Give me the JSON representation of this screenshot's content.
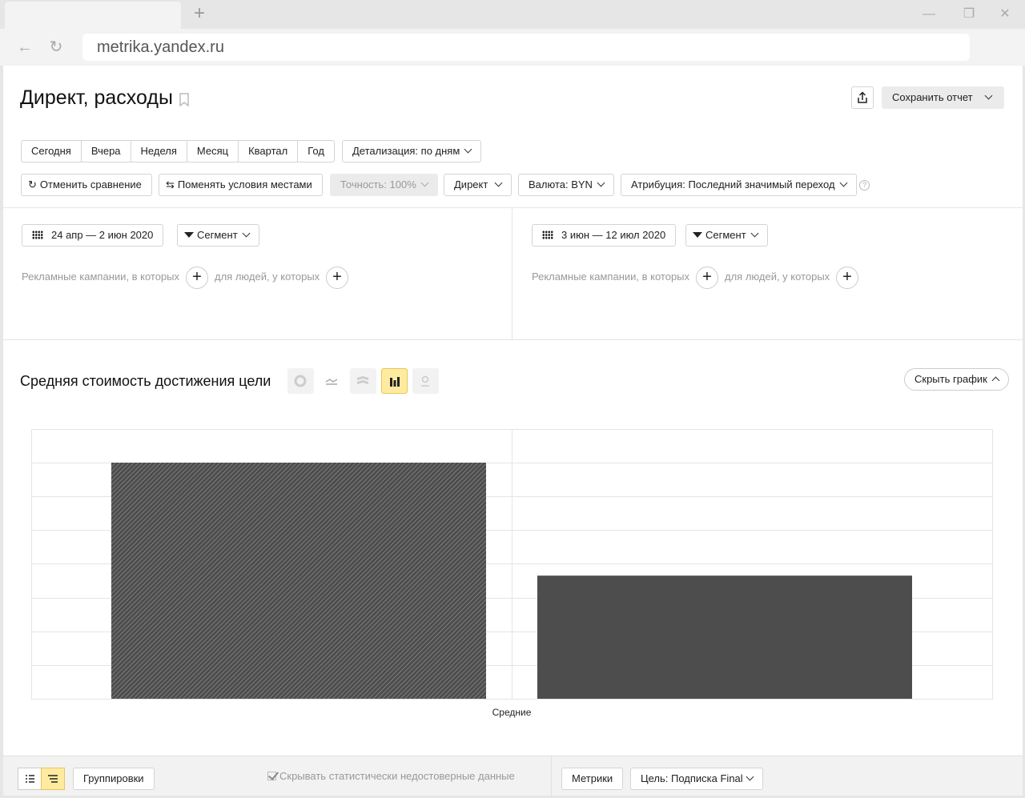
{
  "browser": {
    "address": "metrika.yandex.ru",
    "new_tab_glyph": "+",
    "back_glyph": "←",
    "reload_glyph": "↻",
    "minimize_glyph": "—",
    "restore_glyph": "❐",
    "close_glyph": "✕"
  },
  "report": {
    "title": "Директ, расходы",
    "save_label": "Сохранить отчет",
    "period_buttons": [
      "Сегодня",
      "Вчера",
      "Неделя",
      "Месяц",
      "Квартал",
      "Год"
    ],
    "detail_label": "Детализация: по дням",
    "cancel_compare_label": "Отменить сравнение",
    "swap_label": "Поменять условия местами",
    "accuracy_label": "Точность: 100%",
    "direct_label": "Директ",
    "currency_label": "Валюта: BYN",
    "attribution_label": "Атрибуция: Последний значимый переход",
    "help_glyph": "?"
  },
  "segments": {
    "left": {
      "dates": "24 апр — 2 июн 2020",
      "segment_label": "Сегмент",
      "campaigns_text": "Рекламные кампании, в которых",
      "people_text": "для людей, у которых"
    },
    "right": {
      "dates": "3 июн — 12 июл 2020",
      "segment_label": "Сегмент",
      "campaigns_text": "Рекламные кампании, в которых",
      "people_text": "для людей, у которых"
    },
    "plus_glyph": "+"
  },
  "chart_section": {
    "title": "Средняя стоимость достижения цели",
    "hide_label": "Скрыть график",
    "chart_types": [
      "pie-icon",
      "line-icon",
      "area-icon",
      "bar-icon",
      "map-icon"
    ],
    "active_chart_type": "bar-icon"
  },
  "chart_data": {
    "type": "bar",
    "categories": [
      "Средние"
    ],
    "series": [
      {
        "values": [
          7
        ],
        "fill": "hatched",
        "color": "#4d4d4d"
      },
      {
        "values": [
          3.65
        ],
        "fill": "solid",
        "color": "#4d4d4d"
      }
    ],
    "ylim": [
      0,
      8
    ],
    "grid": true,
    "xlabel": "",
    "ylabel": ""
  },
  "footer": {
    "groupings_label": "Группировки",
    "hide_unreliable_label": "Скрывать статистически недостоверные данные",
    "metrics_label": "Метрики",
    "goal_label": "Цель: Подписка Final"
  }
}
